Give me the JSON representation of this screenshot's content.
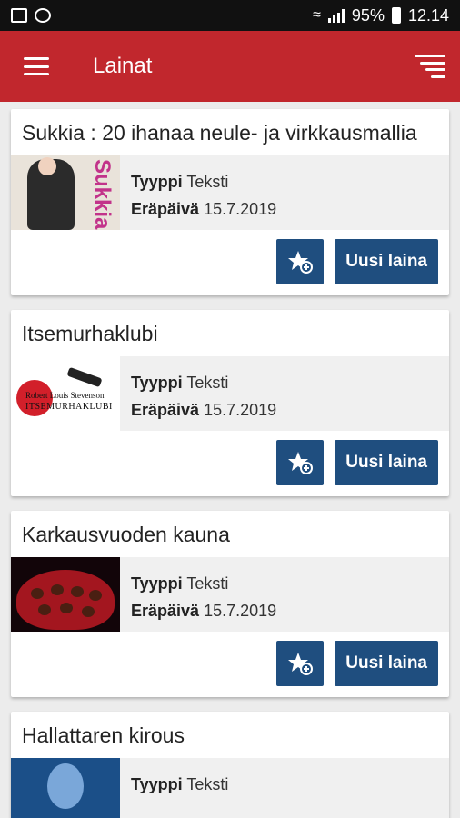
{
  "status_bar": {
    "battery": "95%",
    "time": "12.14"
  },
  "app_bar": {
    "title": "Lainat",
    "menu_icon": "hamburger-menu-icon",
    "sort_icon": "sort-icon"
  },
  "colors": {
    "app_bar": "#c1272d",
    "button": "#1f4e7f",
    "background": "#ececec"
  },
  "loans": [
    {
      "title": "Sukkia : 20 ihanaa neule- ja virkkausmallia",
      "type_label": "Tyyppi",
      "type_value": "Teksti",
      "due_label": "Eräpäivä",
      "due_value": "15.7.2019",
      "renew_label": "Uusi laina"
    },
    {
      "title": "Itsemurhaklubi",
      "type_label": "Tyyppi",
      "type_value": "Teksti",
      "due_label": "Eräpäivä",
      "due_value": "15.7.2019",
      "renew_label": "Uusi laina"
    },
    {
      "title": "Karkausvuoden kauna",
      "type_label": "Tyyppi",
      "type_value": "Teksti",
      "due_label": "Eräpäivä",
      "due_value": "15.7.2019",
      "renew_label": "Uusi laina"
    },
    {
      "title": "Hallattaren kirous",
      "type_label": "Tyyppi",
      "type_value": "Teksti"
    }
  ],
  "thumbs": {
    "sukkia_word": "Sukkia",
    "itse_line1": "Robert Louis Stevenson",
    "itse_line2": "ITSEMURHAKLUBI"
  }
}
